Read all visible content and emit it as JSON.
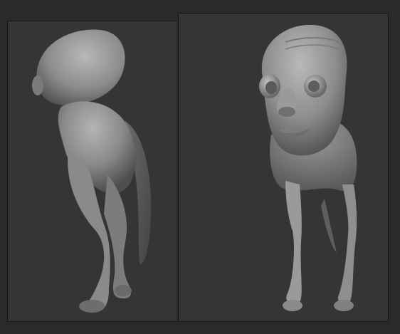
{
  "viewports": [
    {
      "view": "back",
      "model": "sculpt-creature"
    },
    {
      "view": "front",
      "model": "sculpt-creature"
    }
  ],
  "colors": {
    "background": "#2a2a2a",
    "viewport_fill": "#353535",
    "clay_light": "#a9a9a9",
    "clay_mid": "#7d7d7d",
    "clay_dark": "#4a4a4a"
  }
}
